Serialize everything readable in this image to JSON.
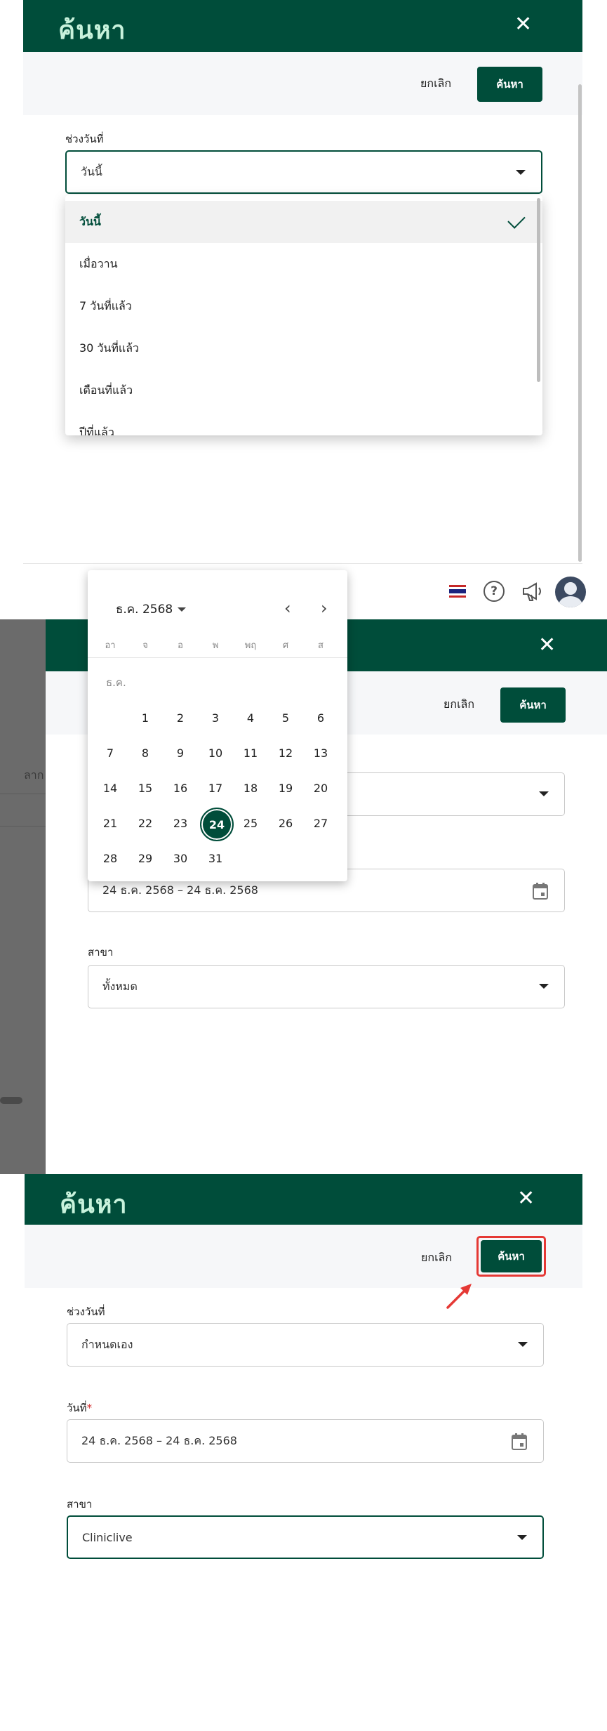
{
  "panel1": {
    "title": "ค้นหา",
    "cancel_label": "ยกเลิก",
    "search_label": "ค้นหา",
    "date_range_label": "ช่วงวันที่",
    "date_range_value": "วันนี้",
    "options": [
      "วันนี้",
      "เมื่อวาน",
      "7 วันที่แล้ว",
      "30 วันที่แล้ว",
      "เดือนที่แล้ว",
      "ปีที่แล้ว"
    ],
    "selected_option": "วันนี้"
  },
  "toolbar": {
    "icons": [
      "thai-flag-icon",
      "help-icon",
      "megaphone-icon",
      "avatar-icon"
    ]
  },
  "panel2": {
    "cancel_label": "ยกเลิก",
    "search_label": "ค้นหา",
    "background_text": "ลาก",
    "date_value": "24 ธ.ค. 2568 – 24 ธ.ค. 2568",
    "branch_label": "สาขา",
    "branch_value": "ทั้งหมด",
    "calendar": {
      "month_label": "ธ.ค. 2568",
      "month_short": "ธ.ค.",
      "weekdays": [
        "อา",
        "จ",
        "อ",
        "พ",
        "พฤ",
        "ศ",
        "ส"
      ],
      "first_weekday_index": 1,
      "days_in_month": 31,
      "selected_day": 24
    }
  },
  "panel3": {
    "title": "ค้นหา",
    "cancel_label": "ยกเลิก",
    "search_label": "ค้นหา",
    "date_range_label": "ช่วงวันที่",
    "date_range_value": "กำหนดเอง",
    "date_label": "วันที่",
    "required_mark": "*",
    "date_value": "24 ธ.ค. 2568 – 24 ธ.ค. 2568",
    "branch_label": "สาขา",
    "branch_value": "Cliniclive"
  },
  "colors": {
    "brand": "#004d3a",
    "title_text": "#c8f2dc",
    "highlight": "#e53935"
  }
}
